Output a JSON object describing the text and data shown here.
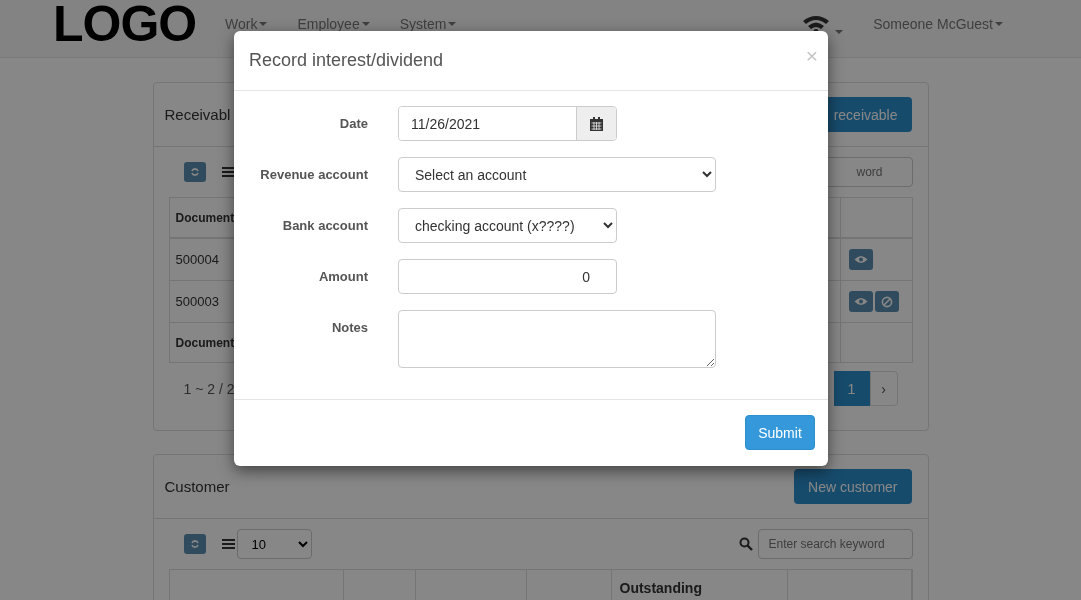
{
  "navbar": {
    "logo": "LOGO",
    "menus": [
      {
        "label": "Work"
      },
      {
        "label": "Employee"
      },
      {
        "label": "System"
      }
    ],
    "user": "Someone McGuest"
  },
  "receivable_panel": {
    "title": "Receivabl",
    "button": "receivable",
    "search": {
      "placeholder": "word"
    },
    "table": {
      "header": "Document",
      "rows": [
        {
          "document": "500004",
          "actions": [
            {
              "kind": "view"
            }
          ]
        },
        {
          "document": "500003",
          "actions": [
            {
              "kind": "view"
            },
            {
              "kind": "cancel"
            }
          ]
        }
      ],
      "footer": "Document"
    },
    "range": "1 ~ 2 / 2",
    "pages": [
      {
        "label": "1",
        "selected": true
      }
    ],
    "next": "›"
  },
  "customer_panel": {
    "title": "Customer",
    "button": "New customer",
    "page_size": "10",
    "search": {
      "placeholder": "Enter search keyword"
    },
    "table": {
      "column_5": "Outstanding"
    }
  },
  "modal": {
    "title": "Record interest/dividend",
    "close": "×",
    "fields": [
      {
        "label": "Date",
        "kind": "date",
        "value": "11/26/2021"
      },
      {
        "label": "Revenue account",
        "kind": "select",
        "value": "Select an account",
        "wide": true
      },
      {
        "label": "Bank account",
        "kind": "select",
        "value": "checking account (x????)",
        "wide": false
      },
      {
        "label": "Amount",
        "kind": "number",
        "value": "0"
      },
      {
        "label": "Notes",
        "kind": "textarea"
      }
    ],
    "submit": "Submit"
  }
}
